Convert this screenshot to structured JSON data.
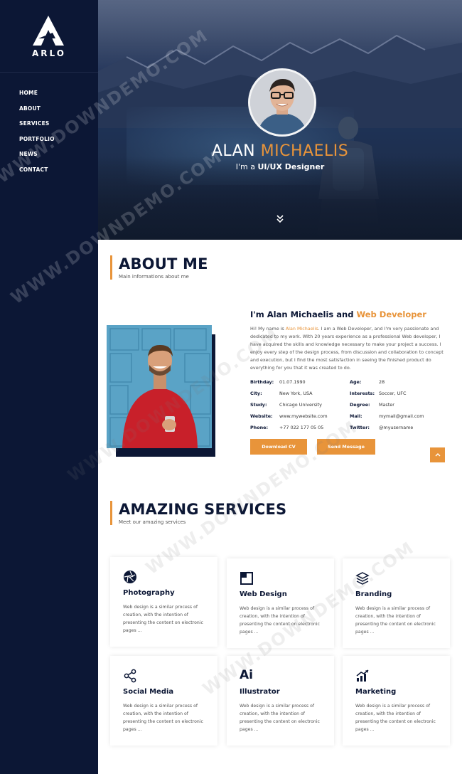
{
  "brand": {
    "name": "ARLO"
  },
  "nav": [
    {
      "label": "HOME"
    },
    {
      "label": "ABOUT"
    },
    {
      "label": "SERVICES"
    },
    {
      "label": "PORTFOLIO"
    },
    {
      "label": "NEWS"
    },
    {
      "label": "CONTACT"
    }
  ],
  "hero": {
    "first_name": "ALAN",
    "last_name": "MICHAELIS",
    "role_prefix": "I'm a",
    "role": "UI/UX Designer"
  },
  "about": {
    "title": "ABOUT ME",
    "subtitle": "Main informations about me",
    "heading_prefix": "I'm Alan Michaelis and",
    "heading_role": "Web Developer",
    "text_1": "Hi! My name is",
    "text_name": "Alan Michaelis",
    "text_2": ". I am a Web Developer, and I'm very passionate and dedicated to my work. With 20 years experience as a professional Web developer, I have acquired the skills and knowledge necessary to make your project a success. I enjoy every step of the design process, from discussion and collaboration to concept and execution, but I find the most satisfaction in seeing the finished product do everything for you that it was created to do.",
    "info": [
      {
        "key": "Birthday:",
        "value": "01.07.1990"
      },
      {
        "key": "Age:",
        "value": "28"
      },
      {
        "key": "City:",
        "value": "New York, USA"
      },
      {
        "key": "Interests:",
        "value": "Soccer, UFC"
      },
      {
        "key": "Study:",
        "value": "Chicago University"
      },
      {
        "key": "Degree:",
        "value": "Master"
      },
      {
        "key": "Website:",
        "value": "www.mywebsite.com"
      },
      {
        "key": "Mail:",
        "value": "mymail@gmail.com"
      },
      {
        "key": "Phone:",
        "value": "+77 022 177 05 05"
      },
      {
        "key": "Twitter:",
        "value": "@myusername"
      }
    ],
    "download_label": "Download CV",
    "message_label": "Send Message"
  },
  "services": {
    "title": "AMAZING SERVICES",
    "subtitle": "Meet our amazing services",
    "items": [
      {
        "name": "Photography",
        "icon": "camera-aperture-icon",
        "desc": "Web design is a similar process of creation, with the intention of presenting the content on electronic pages ..."
      },
      {
        "name": "Web Design",
        "icon": "browser-window-icon",
        "desc": "Web design is a similar process of creation, with the intention of presenting the content on electronic pages ..."
      },
      {
        "name": "Branding",
        "icon": "layers-icon",
        "desc": "Web design is a similar process of creation, with the intention of presenting the content on electronic pages ..."
      },
      {
        "name": "Social Media",
        "icon": "share-icon",
        "desc": "Web design is a similar process of creation, with the intention of presenting the content on electronic pages ..."
      },
      {
        "name": "Illustrator",
        "icon": "illustrator-icon",
        "desc": "Web design is a similar process of creation, with the intention of presenting the content on electronic pages ..."
      },
      {
        "name": "Marketing",
        "icon": "growth-chart-icon",
        "desc": "Web design is a similar process of creation, with the intention of presenting the content on electronic pages ..."
      }
    ]
  },
  "icons": {
    "illustrator_text": "Ai"
  },
  "watermark": "WWW.DOWNDEMO.COM",
  "colors": {
    "navy": "#0c1735",
    "accent": "#e8943a"
  }
}
